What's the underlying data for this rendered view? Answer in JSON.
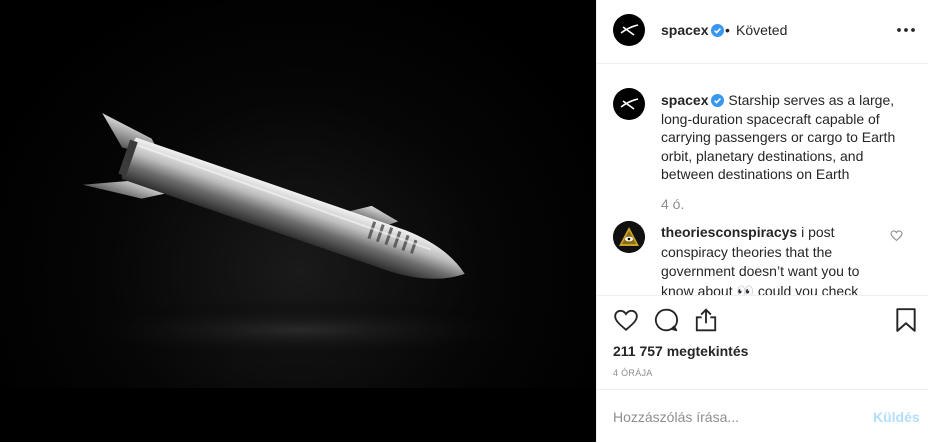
{
  "post": {
    "username": "spacex",
    "separator": "•",
    "follow_status": "Követed",
    "media_alt": "Starship spacecraft rendering"
  },
  "caption": {
    "username": "spacex",
    "text": "Starship serves as a large, long-duration spacecraft capable of carrying passengers or cargo to Earth orbit, planetary destinations, and between destinations on Earth",
    "time": "4 ó."
  },
  "comment": {
    "username": "theoriesconspiracys",
    "text": "i post conspiracy theories that the government doesn’t want you to know about 👀 could you check"
  },
  "stats": {
    "views": "211 757 megtekintés",
    "timestamp": "4 ÓRÁJA"
  },
  "add_comment": {
    "placeholder": "Hozzászólás írása...",
    "send_label": "Küldés"
  },
  "colors": {
    "verified": "#3897f0",
    "send_disabled": "#b2dffc",
    "secondary_text": "#8e8e8e"
  },
  "icons": {
    "more": "more-options-icon",
    "like": "heart-icon",
    "comment": "comment-bubble-icon",
    "share": "share-icon",
    "save": "bookmark-icon"
  }
}
